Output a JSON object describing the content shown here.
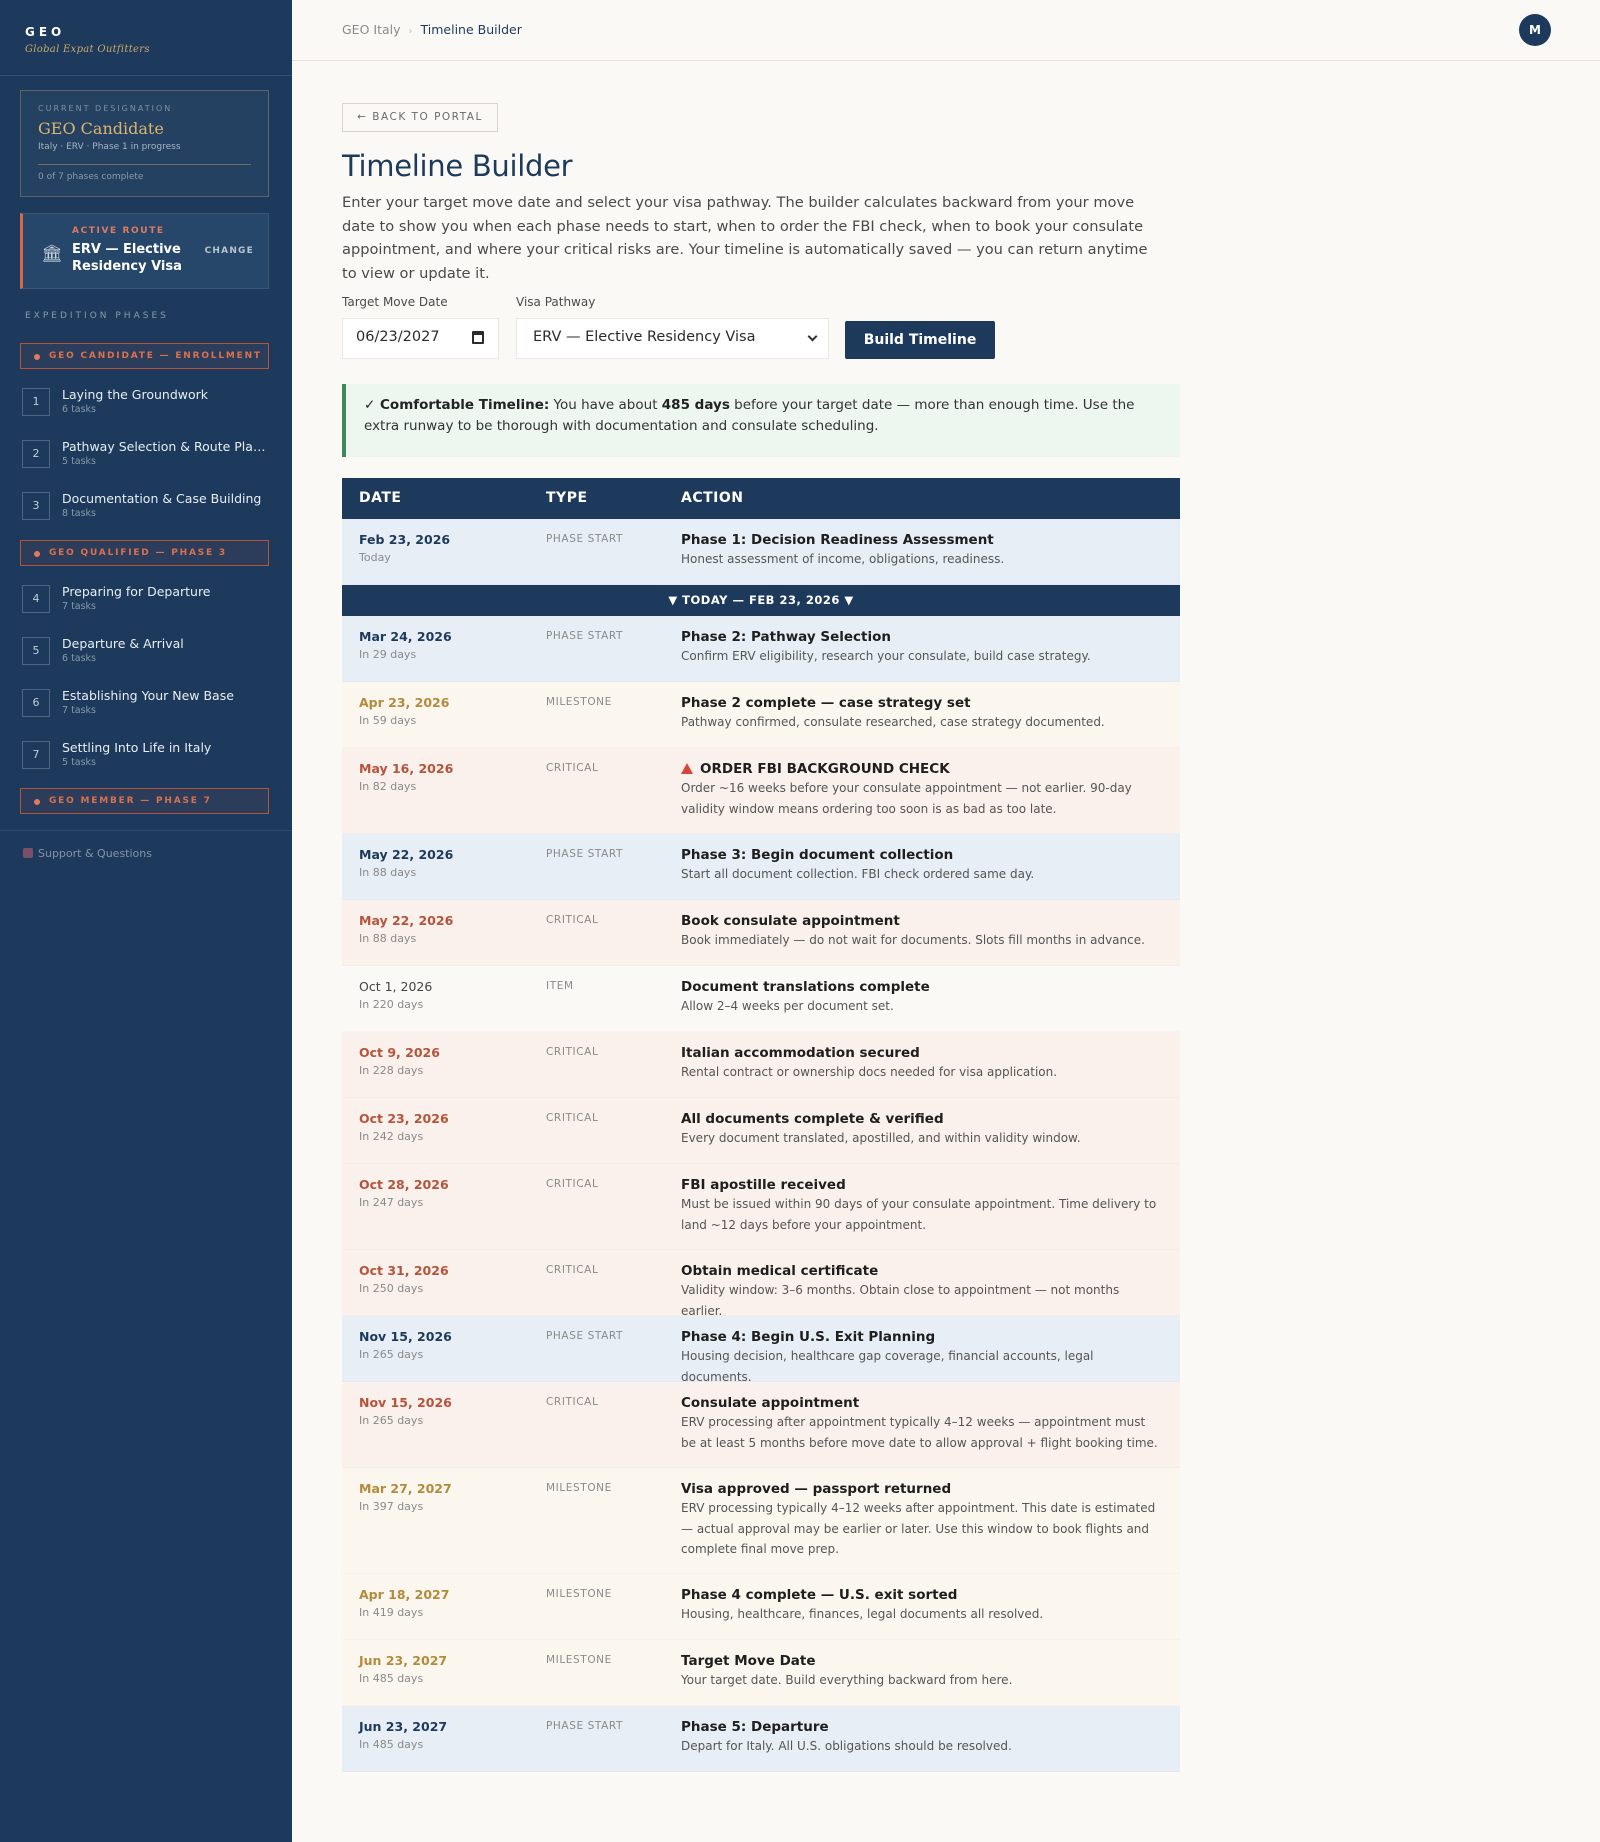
{
  "brand": {
    "name": "GEO",
    "tagline": "Global Expat Outfitters"
  },
  "designation": {
    "label": "CURRENT DESIGNATION",
    "title": "GEO Candidate",
    "subtitle": "Italy · ERV · Phase 1 in progress",
    "progress": "0 of 7 phases complete",
    "progress_fraction": 0
  },
  "route": {
    "label": "ACTIVE ROUTE",
    "icon": "bank-icon",
    "name": "ERV — Elective Residency Visa",
    "change": "CHANGE"
  },
  "phases_heading": "EXPEDITION PHASES",
  "sections": [
    "GEO CANDIDATE — ENROLLMENT",
    "GEO QUALIFIED — PHASE 3",
    "GEO MEMBER — PHASE 7"
  ],
  "phases": [
    {
      "num": "1",
      "title": "Laying the Groundwork",
      "tasks": "6 tasks"
    },
    {
      "num": "2",
      "title": "Pathway Selection & Route Planning",
      "tasks": "5 tasks"
    },
    {
      "num": "3",
      "title": "Documentation & Case Building",
      "tasks": "8 tasks"
    },
    {
      "num": "4",
      "title": "Preparing for Departure",
      "tasks": "7 tasks"
    },
    {
      "num": "5",
      "title": "Departure & Arrival",
      "tasks": "6 tasks"
    },
    {
      "num": "6",
      "title": "Establishing Your New Base",
      "tasks": "7 tasks"
    },
    {
      "num": "7",
      "title": "Settling Into Life in Italy",
      "tasks": "5 tasks"
    }
  ],
  "support": "Support & Questions",
  "breadcrumb": {
    "root": "GEO Italy",
    "sep": "›",
    "current": "Timeline Builder"
  },
  "avatar": "M",
  "back": "← BACK TO PORTAL",
  "title": "Timeline Builder",
  "intro": "Enter your target move date and select your visa pathway. The builder calculates backward from your move date to show you when each phase needs to start, when to order the FBI check, when to book your consulate appointment, and where your critical risks are. Your timeline is automatically saved — you can return anytime to view or update it.",
  "form": {
    "date_label": "Target Move Date",
    "date_value": "06/23/2027",
    "pathway_label": "Visa Pathway",
    "pathway_value": "ERV — Elective Residency Visa",
    "build": "Build Timeline"
  },
  "banner": {
    "lead": "✓ Comfortable Timeline:",
    "pre": " You have about ",
    "days": "485 days",
    "post": " before your target date — more than enough time. Use the extra runway to be thorough with documentation and consulate scheduling."
  },
  "table": {
    "headers": {
      "date": "DATE",
      "type": "TYPE",
      "action": "ACTION"
    },
    "today_bar": "▼ TODAY — FEB 23, 2026 ▼",
    "rows": [
      {
        "kind": "phase",
        "date": "Feb 23, 2026",
        "rel": "Today",
        "type": "PHASE START",
        "title": "Phase 1: Decision Readiness Assessment",
        "desc": "Honest assessment of income, obligations, readiness."
      },
      {
        "kind": "phase",
        "date": "Mar 24, 2026",
        "rel": "In 29 days",
        "type": "PHASE START",
        "title": "Phase 2: Pathway Selection",
        "desc": "Confirm ERV eligibility, research your consulate, build case strategy."
      },
      {
        "kind": "milestone",
        "date": "Apr 23, 2026",
        "rel": "In 59 days",
        "type": "MILESTONE",
        "title": "Phase 2 complete — case strategy set",
        "desc": "Pathway confirmed, consulate researched, case strategy documented."
      },
      {
        "kind": "critical",
        "date": "May 16, 2026",
        "rel": "In 82 days",
        "type": "CRITICAL",
        "title": "ORDER FBI BACKGROUND CHECK",
        "alert": true,
        "desc": "Order ~16 weeks before your consulate appointment — not earlier. 90-day validity window means ordering too soon is as bad as too late."
      },
      {
        "kind": "phase",
        "date": "May 22, 2026",
        "rel": "In 88 days",
        "type": "PHASE START",
        "title": "Phase 3: Begin document collection",
        "desc": "Start all document collection. FBI check ordered same day."
      },
      {
        "kind": "critical",
        "date": "May 22, 2026",
        "rel": "In 88 days",
        "type": "CRITICAL",
        "title": "Book consulate appointment",
        "desc": "Book immediately — do not wait for documents. Slots fill months in advance."
      },
      {
        "kind": "item",
        "date": "Oct 1, 2026",
        "rel": "In 220 days",
        "type": "ITEM",
        "title": "Document translations complete",
        "desc": "Allow 2–4 weeks per document set."
      },
      {
        "kind": "critical",
        "date": "Oct 9, 2026",
        "rel": "In 228 days",
        "type": "CRITICAL",
        "title": "Italian accommodation secured",
        "desc": "Rental contract or ownership docs needed for visa application."
      },
      {
        "kind": "critical",
        "date": "Oct 23, 2026",
        "rel": "In 242 days",
        "type": "CRITICAL",
        "title": "All documents complete & verified",
        "desc": "Every document translated, apostilled, and within validity window."
      },
      {
        "kind": "critical",
        "date": "Oct 28, 2026",
        "rel": "In 247 days",
        "type": "CRITICAL",
        "title": "FBI apostille received",
        "desc": "Must be issued within 90 days of your consulate appointment. Time delivery to land ~12 days before your appointment."
      },
      {
        "kind": "critical",
        "date": "Oct 31, 2026",
        "rel": "In 250 days",
        "type": "CRITICAL",
        "title": "Obtain medical certificate",
        "desc": "Validity window: 3–6 months. Obtain close to appointment — not months earlier."
      },
      {
        "kind": "phase",
        "date": "Nov 15, 2026",
        "rel": "In 265 days",
        "type": "PHASE START",
        "title": "Phase 4: Begin U.S. Exit Planning",
        "desc": "Housing decision, healthcare gap coverage, financial accounts, legal documents."
      },
      {
        "kind": "critical",
        "date": "Nov 15, 2026",
        "rel": "In 265 days",
        "type": "CRITICAL",
        "title": "Consulate appointment",
        "desc": "ERV processing after appointment typically 4–12 weeks — appointment must be at least 5 months before move date to allow approval + flight booking time."
      },
      {
        "kind": "milestone",
        "date": "Mar 27, 2027",
        "rel": "In 397 days",
        "type": "MILESTONE",
        "title": "Visa approved — passport returned",
        "desc": "ERV processing typically 4–12 weeks after appointment. This date is estimated — actual approval may be earlier or later. Use this window to book flights and complete final move prep."
      },
      {
        "kind": "milestone",
        "date": "Apr 18, 2027",
        "rel": "In 419 days",
        "type": "MILESTONE",
        "title": "Phase 4 complete — U.S. exit sorted",
        "desc": "Housing, healthcare, finances, legal documents all resolved."
      },
      {
        "kind": "milestone",
        "date": "Jun 23, 2027",
        "rel": "In 485 days",
        "type": "MILESTONE",
        "title": "Target Move Date",
        "desc": "Your target date. Build everything backward from here."
      },
      {
        "kind": "phase",
        "date": "Jun 23, 2027",
        "rel": "In 485 days",
        "type": "PHASE START",
        "title": "Phase 5: Departure",
        "desc": "Depart for Italy. All U.S. obligations should be resolved."
      }
    ]
  }
}
